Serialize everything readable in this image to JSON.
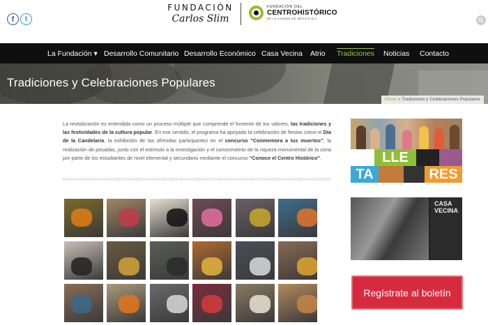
{
  "header": {
    "social": {
      "facebook_glyph": "f",
      "twitter_glyph": "t"
    },
    "logo_fundacion": {
      "line1": "FUNDACIÓN",
      "line2": "Carlos Slim"
    },
    "logo_centro": {
      "line1": "FUNDACIÓN DEL",
      "line2": "CENTROHISTÓRICO",
      "line3": "DE LA CIUDAD DE MÉXICO A.C."
    }
  },
  "nav": {
    "items": [
      {
        "label": "La Fundación ▾"
      },
      {
        "label": "Desarrollo Comunitario"
      },
      {
        "label": "Desarrollo Económico"
      },
      {
        "label": "Casa Vecina"
      },
      {
        "label": "Atrio"
      },
      {
        "label": "Tradiciones"
      },
      {
        "label": "Noticias"
      },
      {
        "label": "Contacto"
      }
    ],
    "active_index": 5,
    "active_color": "#a3c43c"
  },
  "banner": {
    "title": "Tradiciones y Celebraciones Populares"
  },
  "breadcrumb": {
    "home": "Home",
    "separator": " » ",
    "current": "Tradiciones y Celebraciones Populares"
  },
  "intro": {
    "t1": "La revitalización es entendida como un proceso múltiple que comprende el fomento de los valores, ",
    "b1": "las tradiciones y las festividades de la cultura popular",
    "t2": ". En ese sentido, el programa ha apoyado la celebración de fiestas como el ",
    "b2": "Día de la Candelaria",
    "t3": ", la exhibición de las ofrendas participantes en el ",
    "b3": "concurso “Conmemora a tus muertos”",
    "t4": ", la realización de posadas, junto con el estímulo a la investigación y el conocimiento de la riqueza monumental de la zona por parte de los estudiantes de nivel elemental y secundario mediante el concurso ",
    "b4": "“Conoce el Centro Histórico”",
    "t5": "."
  },
  "gallery": {
    "colors": [
      [
        "#7a6a2a",
        "#a08764",
        "#e8e0d4",
        "#6f4a52",
        "#6a6066",
        "#3d6d8e"
      ],
      [
        "#c8c0b4",
        "#6a5a3f",
        "#5a5e57",
        "#b06a2f",
        "#4b4f57",
        "#8a6a52"
      ],
      [
        "#8a6c58",
        "#a99a7a",
        "#6a6a6a",
        "#7b2c3c",
        "#8a7a62",
        "#b38a5e"
      ]
    ],
    "accents": [
      [
        "#e27d14",
        "#c23b4b",
        "#111111",
        "#e26ea2",
        "#c9a72a",
        "#e0742a"
      ],
      [
        "#222222",
        "#d3a23a",
        "#2a2a2a",
        "#e4b33c",
        "#dcdcdc",
        "#e0a52d"
      ],
      [
        "#3a6a8a",
        "#e4761a",
        "#d8d8d8",
        "#d33b3b",
        "#e9e2d5",
        "#c48447"
      ]
    ]
  },
  "sidebar": {
    "talleres_row1": [
      {
        "text": "",
        "color": "#ffffff"
      },
      {
        "text": "LLE",
        "color": "#8fbf3a"
      },
      {
        "text": "",
        "color": "#222222"
      },
      {
        "text": "",
        "color": "#9b5a8d"
      }
    ],
    "talleres_row2": [
      {
        "text": "TA",
        "color": "#3aa8d8"
      },
      {
        "text": "",
        "color": "#c27b3a"
      },
      {
        "text": "",
        "color": "#333333"
      },
      {
        "text": "RES",
        "color": "#f29a2e"
      }
    ],
    "casa_vecina": {
      "line1": "CASA",
      "line2": "VECINA"
    },
    "cta_label": "Regístrate al boletín",
    "cta_color": "#d62b3e"
  }
}
